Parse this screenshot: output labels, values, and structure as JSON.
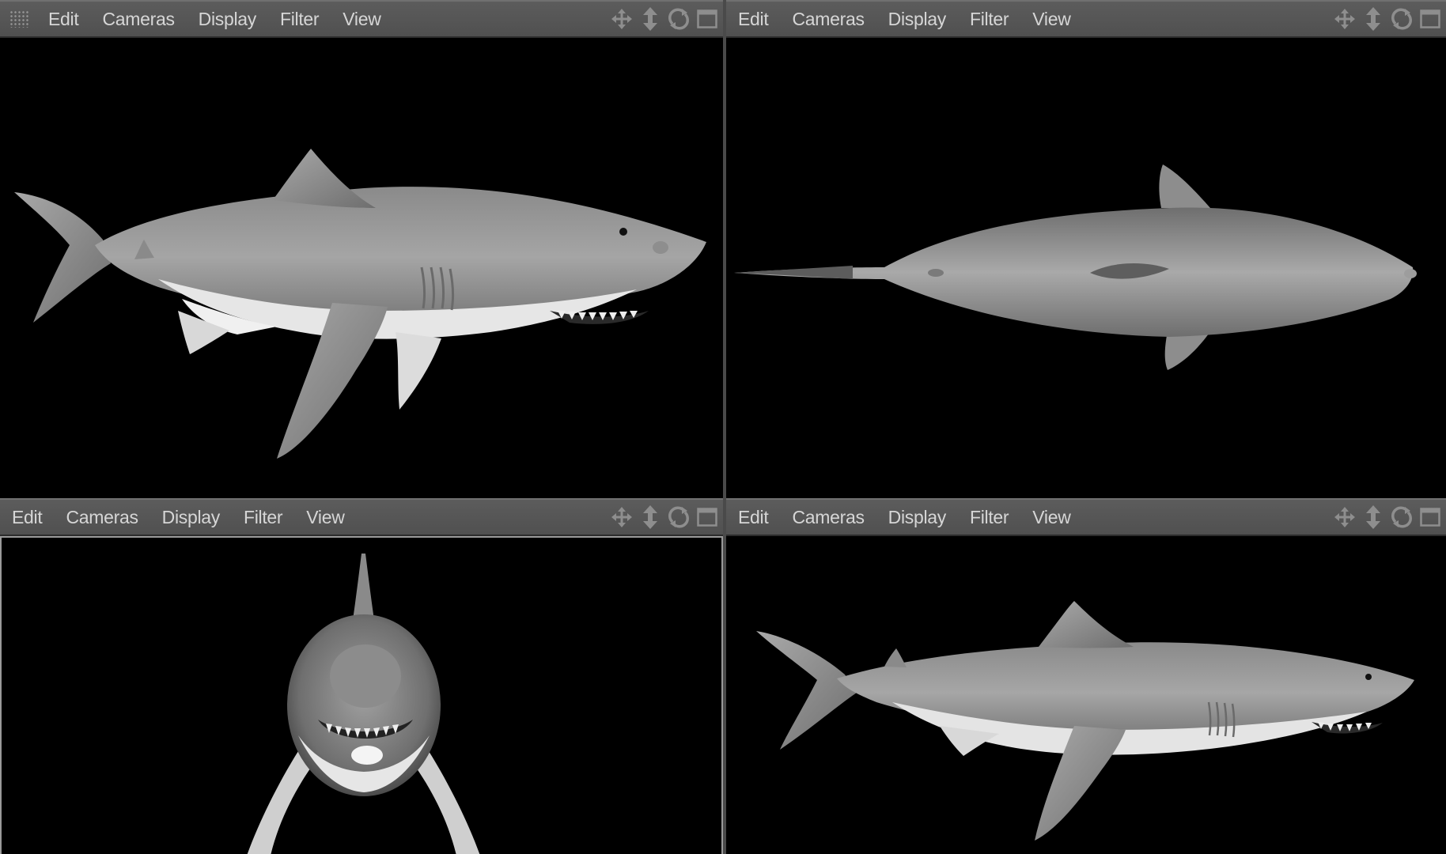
{
  "viewports": [
    {
      "id": "top-left",
      "menus": [
        "Edit",
        "Cameras",
        "Display",
        "Filter",
        "View"
      ],
      "view": "side",
      "has_grip": true
    },
    {
      "id": "top-right",
      "menus": [
        "Edit",
        "Cameras",
        "Display",
        "Filter",
        "View"
      ],
      "view": "top",
      "has_grip": false
    },
    {
      "id": "bottom-left",
      "menus": [
        "Edit",
        "Cameras",
        "Display",
        "Filter",
        "View"
      ],
      "view": "front",
      "has_grip": false
    },
    {
      "id": "bottom-right",
      "menus": [
        "Edit",
        "Cameras",
        "Display",
        "Filter",
        "View"
      ],
      "view": "perspective",
      "has_grip": false
    }
  ],
  "tool_icons": [
    "move-icon",
    "dolly-icon",
    "rotate-icon",
    "maximize-icon"
  ],
  "colors": {
    "menubar": "#555555",
    "menu_text": "#d6d6d6",
    "viewport_bg": "#000000",
    "shark_body": "#9a9a9a",
    "shark_belly": "#e8e8e8"
  }
}
